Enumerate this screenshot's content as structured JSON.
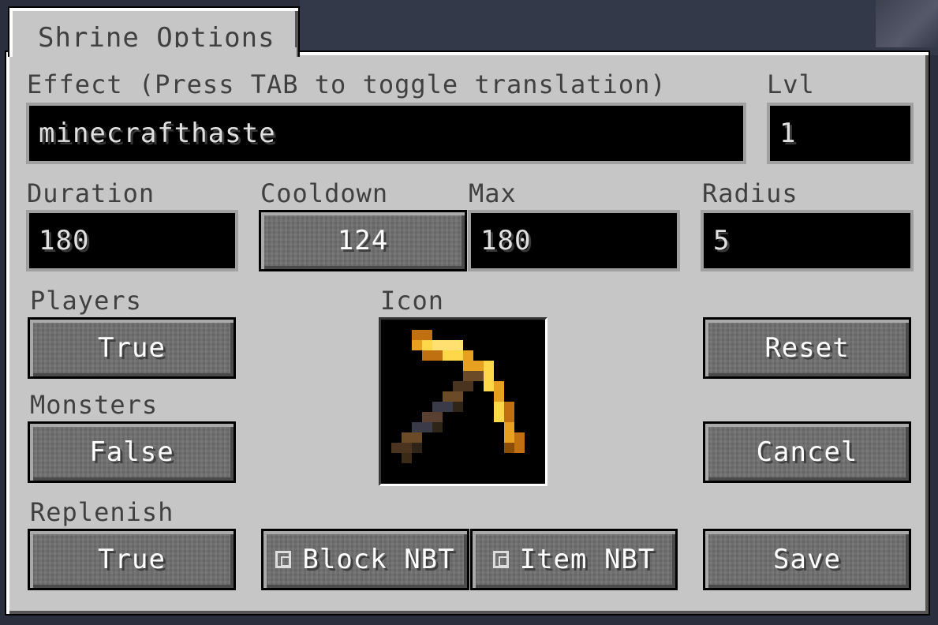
{
  "tab": {
    "label": "Shrine Options"
  },
  "effect": {
    "label": "Effect (Press TAB to toggle translation)",
    "value": "minecrafthaste"
  },
  "level": {
    "label": "Lvl",
    "value": "1"
  },
  "duration": {
    "label": "Duration",
    "value": "180"
  },
  "cooldown": {
    "label": "Cooldown",
    "value": "124"
  },
  "max": {
    "label": "Max",
    "value": "180"
  },
  "radius": {
    "label": "Radius",
    "value": "5"
  },
  "players": {
    "label": "Players",
    "value": "True"
  },
  "monsters": {
    "label": "Monsters",
    "value": "False"
  },
  "replenish": {
    "label": "Replenish",
    "value": "True"
  },
  "icon": {
    "label": "Icon",
    "item": "golden-pickaxe-icon"
  },
  "buttons": {
    "reset": "Reset",
    "cancel": "Cancel",
    "save": "Save",
    "block_nbt": "Block NBT",
    "item_nbt": "Item NBT"
  },
  "colors": {
    "panel": "#c6c6c6",
    "label_text": "#404040",
    "button": "#6f6f6f",
    "field": "#000000"
  }
}
